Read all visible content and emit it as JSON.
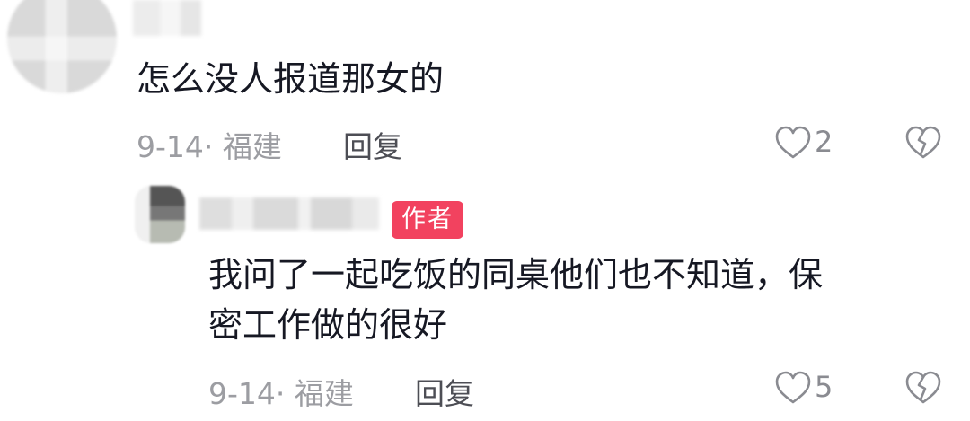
{
  "comments": [
    {
      "text": "怎么没人报道那女的",
      "date": "9-14·",
      "location": "福建",
      "reply_label": "回复",
      "likes": "2"
    },
    {
      "badge": "作者",
      "text_line1": "我问了一起吃饭的同桌他们也不知道，保",
      "text_line2": "密工作做的很好",
      "date": "9-14·",
      "location": "福建",
      "reply_label": "回复",
      "likes": "5"
    }
  ],
  "icons": {
    "like": "heart-outline-icon",
    "dislike": "broken-heart-icon"
  },
  "colors": {
    "badge_bg": "#f2425f",
    "meta_text": "#9c9da2",
    "main_text": "#161823"
  }
}
